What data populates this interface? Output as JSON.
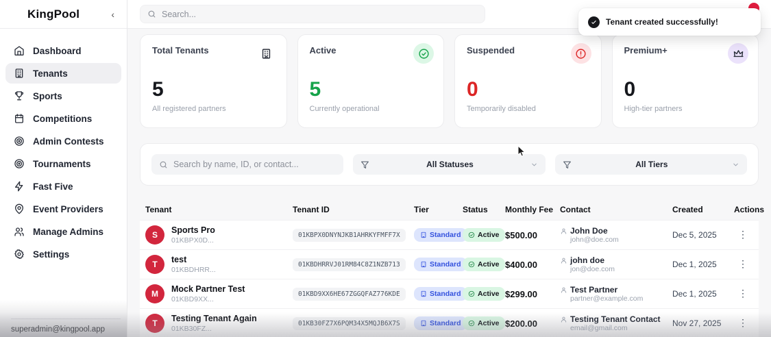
{
  "app": {
    "brand": "KingPool",
    "collapse_glyph": "‹"
  },
  "sidebar": {
    "items": [
      {
        "label": "Dashboard",
        "icon": "home-icon",
        "active": false
      },
      {
        "label": "Tenants",
        "icon": "building-icon",
        "active": true
      },
      {
        "label": "Sports",
        "icon": "trophy-icon",
        "active": false
      },
      {
        "label": "Competitions",
        "icon": "calendar-icon",
        "active": false
      },
      {
        "label": "Admin Contests",
        "icon": "target-icon",
        "active": false
      },
      {
        "label": "Tournaments",
        "icon": "target-icon",
        "active": false
      },
      {
        "label": "Fast Five",
        "icon": "zap-icon",
        "active": false
      },
      {
        "label": "Event Providers",
        "icon": "map-pin-icon",
        "active": false
      },
      {
        "label": "Manage Admins",
        "icon": "users-icon",
        "active": false
      },
      {
        "label": "Settings",
        "icon": "gear-icon",
        "active": false
      }
    ],
    "footer_email": "superadmin@kingpool.app"
  },
  "topbar": {
    "search_placeholder": "Search..."
  },
  "toast": {
    "message": "Tenant created successfully!"
  },
  "stats": [
    {
      "title": "Total Tenants",
      "value": "5",
      "subtitle": "All registered partners",
      "icon": "building-icon",
      "value_color": "#16181d",
      "icon_color": "#2a2f3a",
      "icon_bg": "transparent"
    },
    {
      "title": "Active",
      "value": "5",
      "subtitle": "Currently operational",
      "icon": "check-circle-icon",
      "value_color": "#16a34a",
      "icon_color": "#16a34a",
      "icon_bg": "#dcf7e6"
    },
    {
      "title": "Suspended",
      "value": "0",
      "subtitle": "Temporarily disabled",
      "icon": "alert-circle-icon",
      "value_color": "#dc2626",
      "icon_color": "#dc2626",
      "icon_bg": "#fde2e4"
    },
    {
      "title": "Premium+",
      "value": "0",
      "subtitle": "High-tier partners",
      "icon": "crown-icon",
      "value_color": "#16181d",
      "icon_color": "#2a2f3a",
      "icon_bg": "#ebe2fb"
    }
  ],
  "filters": {
    "search_placeholder": "Search by name, ID, or contact...",
    "status_value": "All Statuses",
    "tier_value": "All Tiers"
  },
  "table": {
    "columns": [
      "Tenant",
      "Tenant ID",
      "Tier",
      "Status",
      "Monthly Fee",
      "Contact",
      "Created",
      "Actions"
    ],
    "rows": [
      {
        "avatar": "S",
        "name": "Sports Pro",
        "id_short": "01KBPX0D...",
        "tenant_id": "01KBPX0DNYNJKB1AHRKYFMFF7X",
        "tier": "Standard",
        "status": "Active",
        "fee": "$500.00",
        "contact_name": "John Doe",
        "contact_email": "john@doe.com",
        "created": "Dec 5, 2025"
      },
      {
        "avatar": "T",
        "name": "test",
        "id_short": "01KBDHRR...",
        "tenant_id": "01KBDHRRVJ01RM84C8Z1NZB713",
        "tier": "Standard",
        "status": "Active",
        "fee": "$400.00",
        "contact_name": "john doe",
        "contact_email": "jon@doe.com",
        "created": "Dec 1, 2025"
      },
      {
        "avatar": "M",
        "name": "Mock Partner Test",
        "id_short": "01KBD9XX...",
        "tenant_id": "01KBD9XX6HE67ZGGQFAZ776KDE",
        "tier": "Standard",
        "status": "Active",
        "fee": "$299.00",
        "contact_name": "Test Partner",
        "contact_email": "partner@example.com",
        "created": "Dec 1, 2025"
      },
      {
        "avatar": "T",
        "name": "Testing Tenant Again",
        "id_short": "01KB30FZ...",
        "tenant_id": "01KB30FZ7X6PQM34X5MQJB6X7S",
        "tier": "Standard",
        "status": "Active",
        "fee": "$200.00",
        "contact_name": "Testing Tenant Contact",
        "contact_email": "email@gmail.com",
        "created": "Nov 27, 2025"
      }
    ]
  }
}
